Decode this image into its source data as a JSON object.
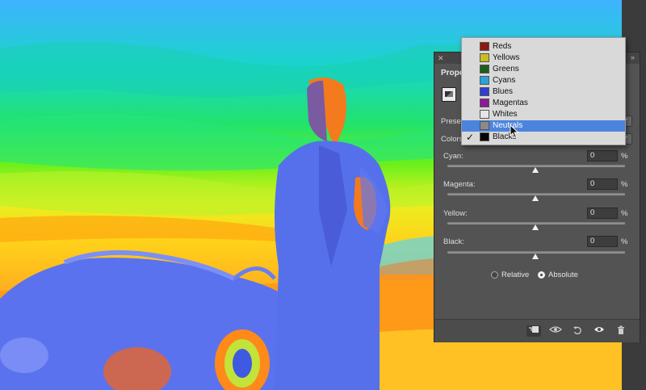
{
  "panel": {
    "title": "Prope",
    "preset_label": "Prese",
    "colors_label": "Colors",
    "sliders": [
      {
        "label": "Cyan:",
        "value": "0",
        "unit": "%"
      },
      {
        "label": "Magenta:",
        "value": "0",
        "unit": "%"
      },
      {
        "label": "Yellow:",
        "value": "0",
        "unit": "%"
      },
      {
        "label": "Black:",
        "value": "0",
        "unit": "%"
      }
    ],
    "method": {
      "relative": "Relative",
      "absolute": "Absolute",
      "selected": "absolute"
    }
  },
  "colors_menu": {
    "items": [
      {
        "label": "Reds",
        "swatch": "#8b1a10"
      },
      {
        "label": "Yellows",
        "swatch": "#c8bd22"
      },
      {
        "label": "Greens",
        "swatch": "#1c5e1a"
      },
      {
        "label": "Cyans",
        "swatch": "#2aa3d8"
      },
      {
        "label": "Blues",
        "swatch": "#2f3fd6"
      },
      {
        "label": "Magentas",
        "swatch": "#8c1a9a"
      },
      {
        "label": "Whites",
        "swatch": "#e6e6e6"
      },
      {
        "label": "Neutrals",
        "swatch": "#8a8a8a"
      },
      {
        "label": "Blacks",
        "swatch": "#050505"
      }
    ],
    "highlighted": "Neutrals",
    "checked": "Blacks"
  },
  "colors": {
    "highlight": "#4b84dd",
    "panel_bg": "#535353"
  },
  "icons": {
    "footer": [
      "clip-to-layer-icon",
      "view-previous-state-icon",
      "reset-icon",
      "visibility-eye-icon",
      "trash-icon"
    ]
  }
}
